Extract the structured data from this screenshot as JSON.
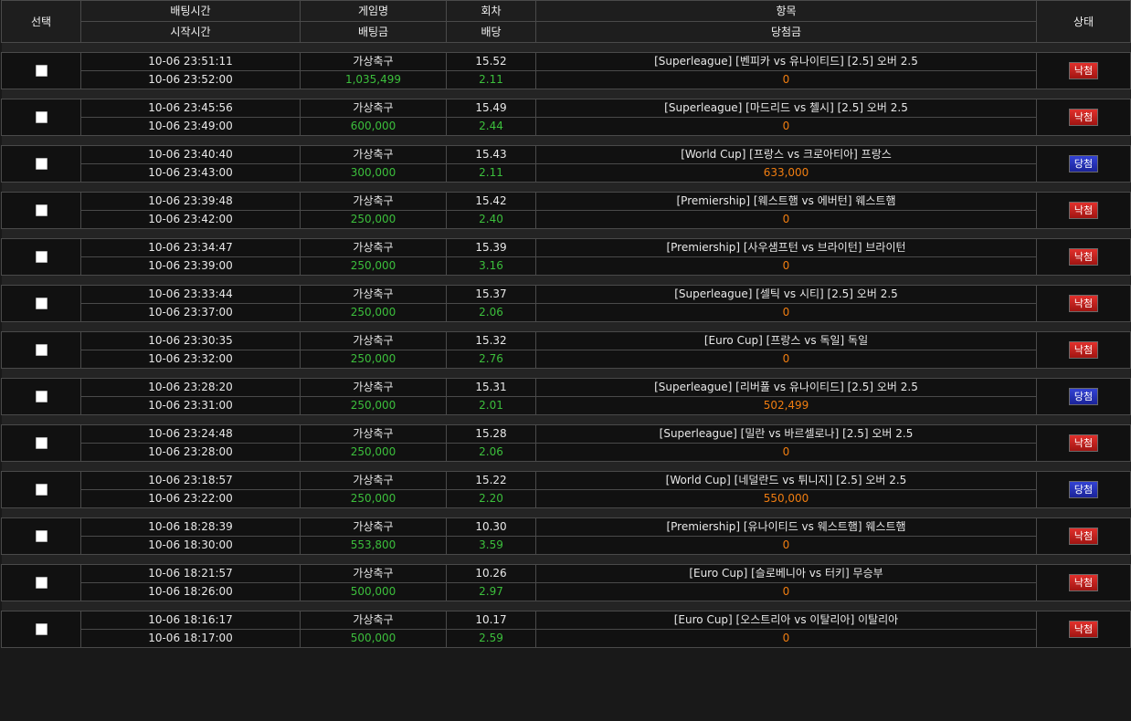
{
  "headers": {
    "select": "선택",
    "bet_time": "배팅시간",
    "start_time": "시작시간",
    "game_name": "게임명",
    "bet_amount": "배팅금",
    "round": "회차",
    "odds": "배당",
    "item": "항목",
    "win_amount": "당첨금",
    "status": "상태"
  },
  "colors": {
    "amount_green": "#3cbf3c",
    "payout_orange": "#f07d10",
    "lose_badge": "#c8201d",
    "win_badge": "#2a36c4"
  },
  "bets": [
    {
      "bet_time": "10-06 23:51:11",
      "start_time": "10-06 23:52:00",
      "game": "가상축구",
      "amount": "1,035,499",
      "round": "15.52",
      "odds": "2.11",
      "item": "[Superleague] [벤피카 vs 유나이티드] [2.5] 오버 2.5",
      "payout": "0",
      "status": "낙첨",
      "status_type": "lose"
    },
    {
      "bet_time": "10-06 23:45:56",
      "start_time": "10-06 23:49:00",
      "game": "가상축구",
      "amount": "600,000",
      "round": "15.49",
      "odds": "2.44",
      "item": "[Superleague] [마드리드 vs 첼시] [2.5] 오버 2.5",
      "payout": "0",
      "status": "낙첨",
      "status_type": "lose"
    },
    {
      "bet_time": "10-06 23:40:40",
      "start_time": "10-06 23:43:00",
      "game": "가상축구",
      "amount": "300,000",
      "round": "15.43",
      "odds": "2.11",
      "item": "[World Cup] [프랑스 vs 크로아티아] 프랑스",
      "payout": "633,000",
      "status": "당첨",
      "status_type": "win"
    },
    {
      "bet_time": "10-06 23:39:48",
      "start_time": "10-06 23:42:00",
      "game": "가상축구",
      "amount": "250,000",
      "round": "15.42",
      "odds": "2.40",
      "item": "[Premiership] [웨스트햄 vs 에버턴] 웨스트햄",
      "payout": "0",
      "status": "낙첨",
      "status_type": "lose"
    },
    {
      "bet_time": "10-06 23:34:47",
      "start_time": "10-06 23:39:00",
      "game": "가상축구",
      "amount": "250,000",
      "round": "15.39",
      "odds": "3.16",
      "item": "[Premiership] [사우샘프턴 vs 브라이턴] 브라이턴",
      "payout": "0",
      "status": "낙첨",
      "status_type": "lose"
    },
    {
      "bet_time": "10-06 23:33:44",
      "start_time": "10-06 23:37:00",
      "game": "가상축구",
      "amount": "250,000",
      "round": "15.37",
      "odds": "2.06",
      "item": "[Superleague] [셀틱 vs 시티] [2.5] 오버 2.5",
      "payout": "0",
      "status": "낙첨",
      "status_type": "lose"
    },
    {
      "bet_time": "10-06 23:30:35",
      "start_time": "10-06 23:32:00",
      "game": "가상축구",
      "amount": "250,000",
      "round": "15.32",
      "odds": "2.76",
      "item": "[Euro Cup] [프랑스 vs 독일] 독일",
      "payout": "0",
      "status": "낙첨",
      "status_type": "lose"
    },
    {
      "bet_time": "10-06 23:28:20",
      "start_time": "10-06 23:31:00",
      "game": "가상축구",
      "amount": "250,000",
      "round": "15.31",
      "odds": "2.01",
      "item": "[Superleague] [리버풀 vs 유나이티드] [2.5] 오버 2.5",
      "payout": "502,499",
      "status": "당첨",
      "status_type": "win"
    },
    {
      "bet_time": "10-06 23:24:48",
      "start_time": "10-06 23:28:00",
      "game": "가상축구",
      "amount": "250,000",
      "round": "15.28",
      "odds": "2.06",
      "item": "[Superleague] [밀란 vs 바르셀로나] [2.5] 오버 2.5",
      "payout": "0",
      "status": "낙첨",
      "status_type": "lose"
    },
    {
      "bet_time": "10-06 23:18:57",
      "start_time": "10-06 23:22:00",
      "game": "가상축구",
      "amount": "250,000",
      "round": "15.22",
      "odds": "2.20",
      "item": "[World Cup] [네덜란드 vs 튀니지] [2.5] 오버 2.5",
      "payout": "550,000",
      "status": "당첨",
      "status_type": "win"
    },
    {
      "bet_time": "10-06 18:28:39",
      "start_time": "10-06 18:30:00",
      "game": "가상축구",
      "amount": "553,800",
      "round": "10.30",
      "odds": "3.59",
      "item": "[Premiership] [유나이티드 vs 웨스트햄] 웨스트햄",
      "payout": "0",
      "status": "낙첨",
      "status_type": "lose"
    },
    {
      "bet_time": "10-06 18:21:57",
      "start_time": "10-06 18:26:00",
      "game": "가상축구",
      "amount": "500,000",
      "round": "10.26",
      "odds": "2.97",
      "item": "[Euro Cup] [슬로베니아 vs 터키] 무승부",
      "payout": "0",
      "status": "낙첨",
      "status_type": "lose"
    },
    {
      "bet_time": "10-06 18:16:17",
      "start_time": "10-06 18:17:00",
      "game": "가상축구",
      "amount": "500,000",
      "round": "10.17",
      "odds": "2.59",
      "item": "[Euro Cup] [오스트리아 vs 이탈리아] 이탈리아",
      "payout": "0",
      "status": "낙첨",
      "status_type": "lose"
    }
  ]
}
